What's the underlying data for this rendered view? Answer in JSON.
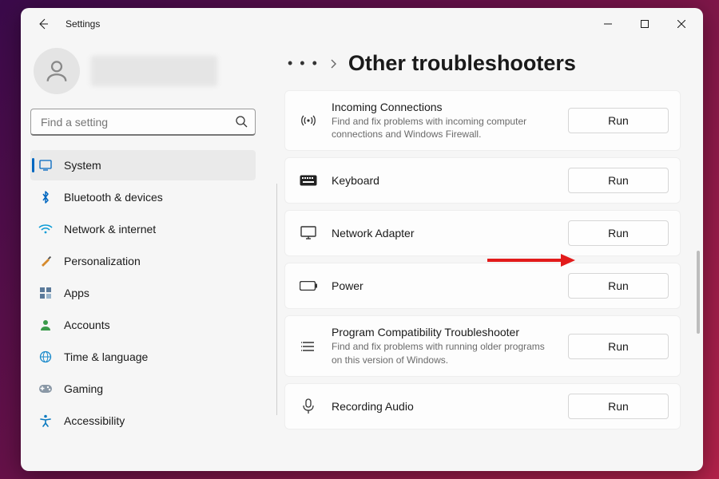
{
  "app_title": "Settings",
  "search": {
    "placeholder": "Find a setting"
  },
  "nav": [
    {
      "key": "system",
      "label": "System",
      "icon": "system",
      "active": true
    },
    {
      "key": "bluetooth",
      "label": "Bluetooth & devices",
      "icon": "bluetooth",
      "active": false
    },
    {
      "key": "network",
      "label": "Network & internet",
      "icon": "wifi",
      "active": false
    },
    {
      "key": "personalization",
      "label": "Personalization",
      "icon": "brush",
      "active": false
    },
    {
      "key": "apps",
      "label": "Apps",
      "icon": "apps",
      "active": false
    },
    {
      "key": "accounts",
      "label": "Accounts",
      "icon": "account",
      "active": false
    },
    {
      "key": "time",
      "label": "Time & language",
      "icon": "globe",
      "active": false
    },
    {
      "key": "gaming",
      "label": "Gaming",
      "icon": "gaming",
      "active": false
    },
    {
      "key": "accessibility",
      "label": "Accessibility",
      "icon": "accessibility",
      "active": false
    }
  ],
  "breadcrumb": {
    "ellipsis": "• • •",
    "current": "Other troubleshooters"
  },
  "run_label": "Run",
  "items": [
    {
      "key": "incoming",
      "title": "Incoming Connections",
      "desc": "Find and fix problems with incoming computer connections and Windows Firewall.",
      "icon": "antenna"
    },
    {
      "key": "keyboard",
      "title": "Keyboard",
      "desc": "",
      "icon": "keyboard"
    },
    {
      "key": "netadapter",
      "title": "Network Adapter",
      "desc": "",
      "icon": "monitor",
      "highlight": true
    },
    {
      "key": "power",
      "title": "Power",
      "desc": "",
      "icon": "battery"
    },
    {
      "key": "compat",
      "title": "Program Compatibility Troubleshooter",
      "desc": "Find and fix problems with running older programs on this version of Windows.",
      "icon": "list"
    },
    {
      "key": "recaudio",
      "title": "Recording Audio",
      "desc": "",
      "icon": "mic"
    }
  ]
}
